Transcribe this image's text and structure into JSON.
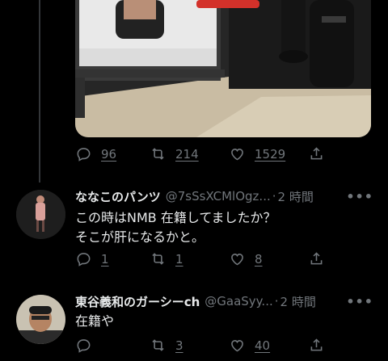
{
  "tweet_main": {
    "reply_count": "96",
    "retweet_count": "214",
    "like_count": "1529"
  },
  "replies": [
    {
      "name": "ななこのパンツ",
      "handle": "@7sSsXCMlOgz...",
      "separator": "·",
      "time": "2 時間",
      "more": "•••",
      "lines": [
        "この時はNMB 在籍してましたか？",
        "そこが肝になるかと。"
      ],
      "reply_count": "1",
      "retweet_count": "1",
      "like_count": "8"
    },
    {
      "name": "東谷義和のガーシーch",
      "handle": "@GaaSyy...",
      "separator": "·",
      "time": "2 時間",
      "more": "•••",
      "lines": [
        "在籍や"
      ],
      "reply_count": "",
      "retweet_count": "3",
      "like_count": "40"
    }
  ],
  "colors": {
    "background": "#000000",
    "text": "#e7e9ea",
    "secondary": "#71767b",
    "thread_line": "#333639",
    "media_accent_red": "#d3312a"
  }
}
